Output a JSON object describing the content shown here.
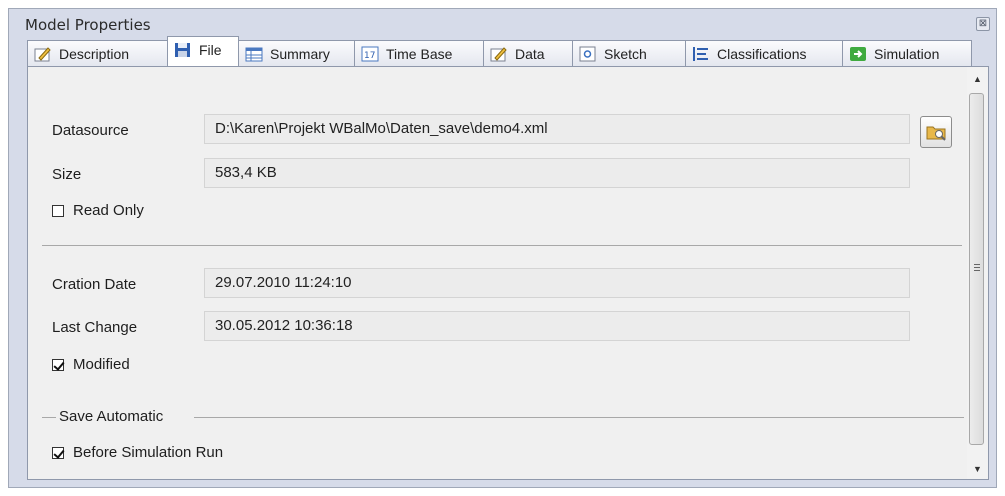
{
  "window": {
    "title": "Model Properties",
    "close_glyph": "⊠"
  },
  "tabs": [
    {
      "label": "Description",
      "icon": "edit-icon",
      "active": false
    },
    {
      "label": "File",
      "icon": "save-disk-icon",
      "active": true
    },
    {
      "label": "Summary",
      "icon": "summary-table-icon",
      "active": false
    },
    {
      "label": "Time Base",
      "icon": "calendar-icon",
      "active": false
    },
    {
      "label": "Data",
      "icon": "edit-data-icon",
      "active": false
    },
    {
      "label": "Sketch",
      "icon": "sketch-icon",
      "active": false
    },
    {
      "label": "Classifications",
      "icon": "classification-icon",
      "active": false
    },
    {
      "label": "Simulation",
      "icon": "run-simulation-icon",
      "active": false
    }
  ],
  "file": {
    "datasource_label": "Datasource",
    "datasource_value": "D:\\Karen\\Projekt WBalMo\\Daten_save\\demo4.xml",
    "size_label": "Size",
    "size_value": "583,4 KB",
    "read_only_label": "Read Only",
    "read_only_checked": false,
    "creation_label": "Cration Date",
    "creation_value": "29.07.2010 11:24:10",
    "last_change_label": "Last Change",
    "last_change_value": "30.05.2012 10:36:18",
    "modified_label": "Modified",
    "modified_checked": true,
    "save_group_label": "Save Automatic",
    "before_run_label": "Before Simulation Run",
    "before_run_checked": true
  },
  "colors": {
    "panel_bg": "#f0f0f0",
    "window_bg": "#d6dbe9",
    "field_bg": "#ececec"
  }
}
